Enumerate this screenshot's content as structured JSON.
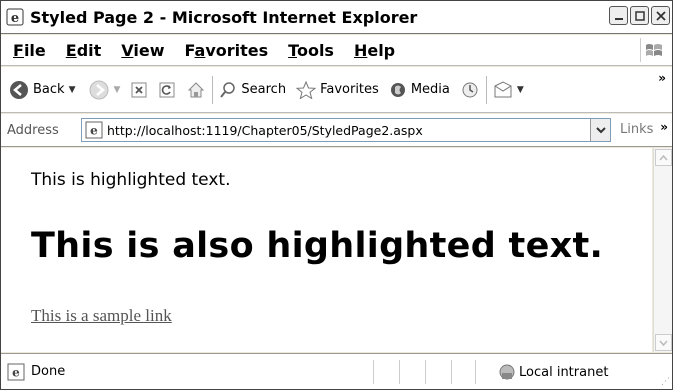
{
  "window": {
    "title": "Styled Page 2 - Microsoft Internet Explorer"
  },
  "menu": {
    "items": [
      {
        "label_u": "F",
        "label_rest": "ile"
      },
      {
        "label_u": "E",
        "label_rest": "dit"
      },
      {
        "label_u": "V",
        "label_rest": "iew"
      },
      {
        "label_pre": "F",
        "label_u": "a",
        "label_rest": "vorites"
      },
      {
        "label_u": "T",
        "label_rest": "ools"
      },
      {
        "label_u": "H",
        "label_rest": "elp"
      }
    ]
  },
  "toolbar": {
    "back_label": "Back",
    "search_label": "Search",
    "favorites_label": "Favorites",
    "media_label": "Media"
  },
  "address": {
    "label": "Address",
    "url": "http://localhost:1119/Chapter05/StyledPage2.aspx",
    "links_label": "Links"
  },
  "content": {
    "paragraph": "This is highlighted text.",
    "heading": "This is also highlighted text.",
    "link": "This is a sample link"
  },
  "status": {
    "text": "Done",
    "zone": "Local intranet"
  },
  "colors": {
    "link": "#555555",
    "border": "#7f9db9"
  }
}
